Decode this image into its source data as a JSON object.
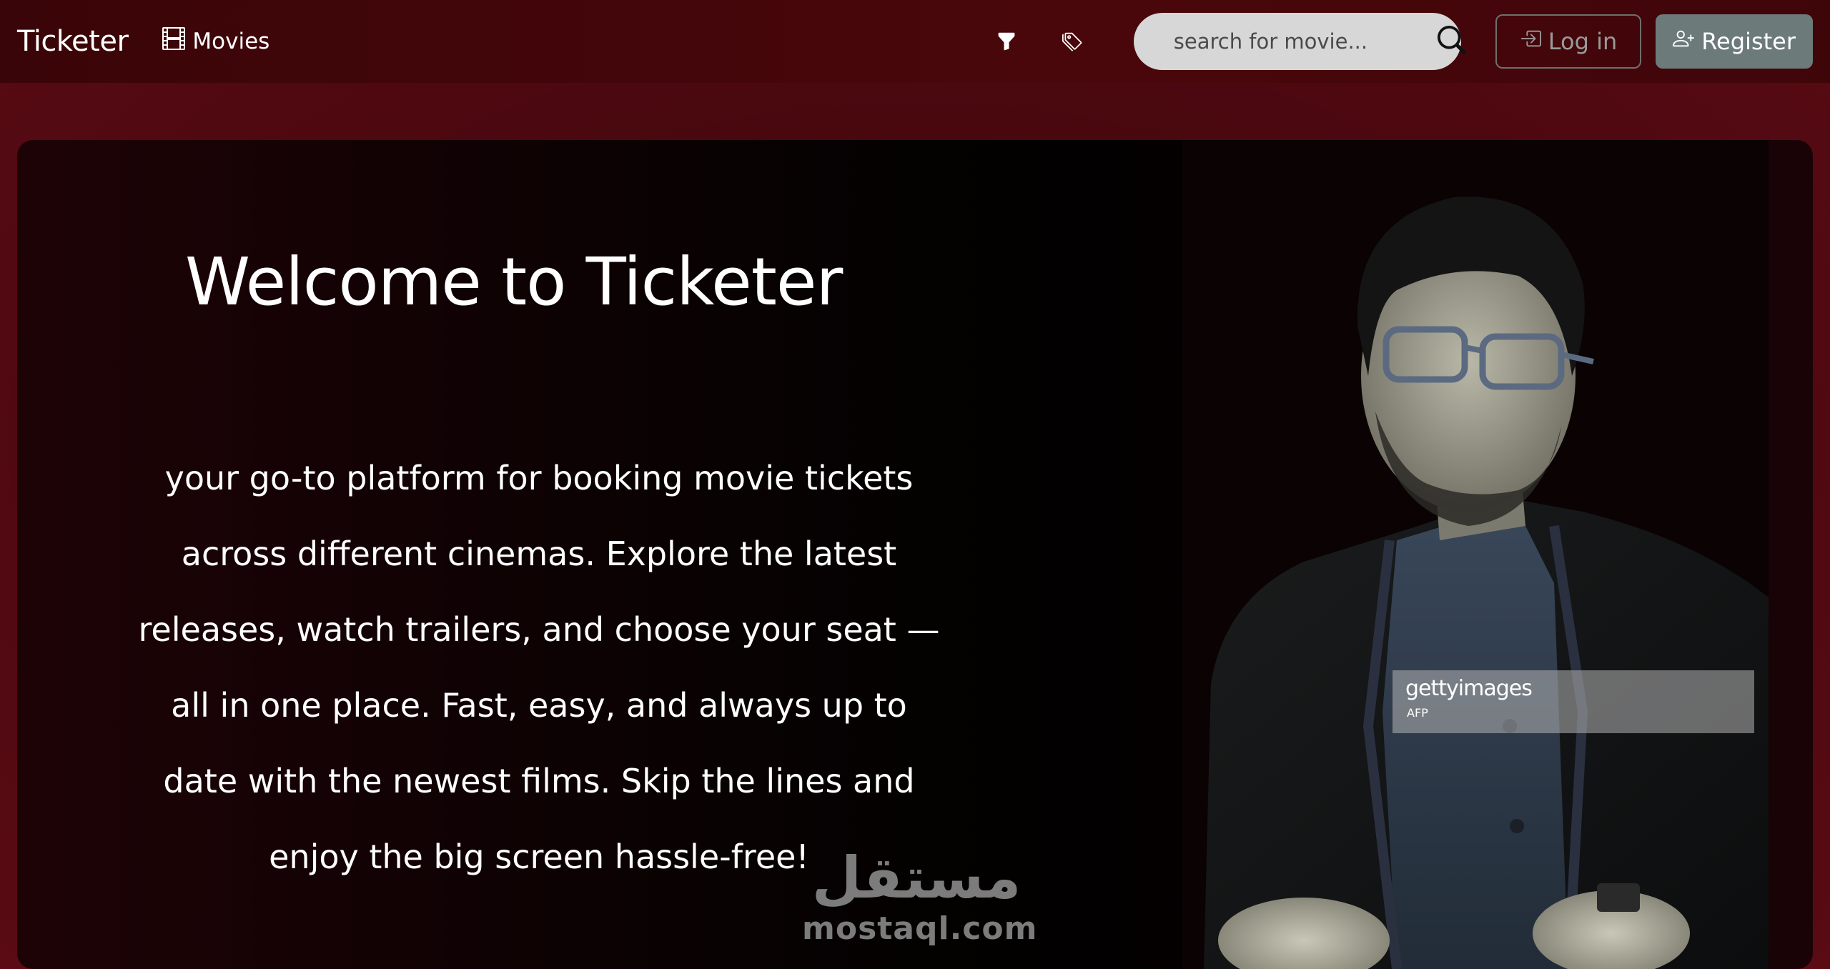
{
  "navbar": {
    "brand": "Ticketer",
    "movies_label": "Movies",
    "search_placeholder": "search for movie...",
    "login_label": "Log in",
    "register_label": "Register"
  },
  "hero": {
    "title": "Welcome to Ticketer",
    "lines": [
      "your go-to platform for booking movie tickets",
      "across different cinemas. Explore the latest",
      "releases, watch trailers, and choose your seat —",
      "all in one place. Fast, easy, and always up to",
      "date with the newest films. Skip the lines and",
      "enjoy the big screen hassle-free!"
    ]
  },
  "photo": {
    "getty_logo": "gettyimages",
    "getty_sub": "AFP"
  },
  "watermark": {
    "arabic": "مستقل",
    "latin": "mostaql.com"
  },
  "colors": {
    "navbar_bg": "#3f0609",
    "page_bg": "#4d0810",
    "search_bg": "#d7d7d7",
    "register_bg": "#6c7a7a"
  },
  "icons": {
    "movies": "film-icon",
    "filter": "filter-icon",
    "tags": "tags-icon",
    "search": "search-icon",
    "login": "login-icon",
    "register": "person-plus-icon"
  }
}
